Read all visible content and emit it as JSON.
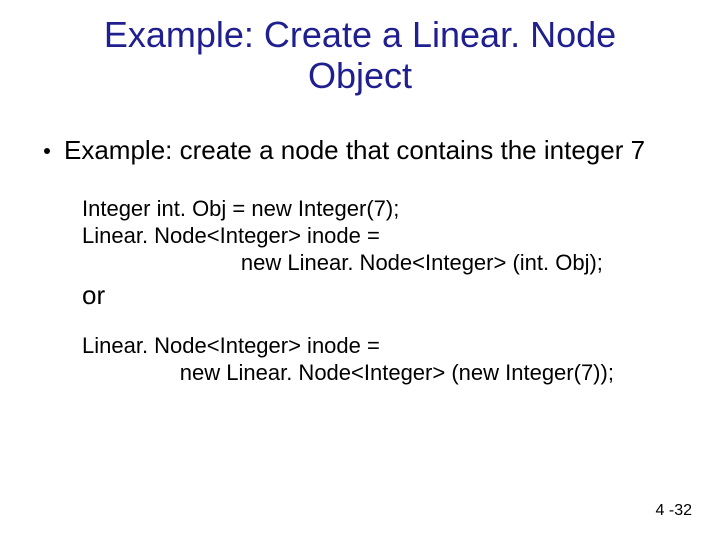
{
  "title_line1": "Example: Create a Linear. Node",
  "title_line2": "Object",
  "bullet": "Example: create a node that contains the integer 7",
  "code1": {
    "l1": "Integer int. Obj = new Integer(7);",
    "l2": "Linear. Node<Integer> inode =",
    "l3": "                          new Linear. Node<Integer> (int. Obj);"
  },
  "or_label": "or",
  "code2": {
    "l1": "Linear. Node<Integer> inode =",
    "l2": "                new Linear. Node<Integer> (new Integer(7));"
  },
  "page_number": "4 -32"
}
